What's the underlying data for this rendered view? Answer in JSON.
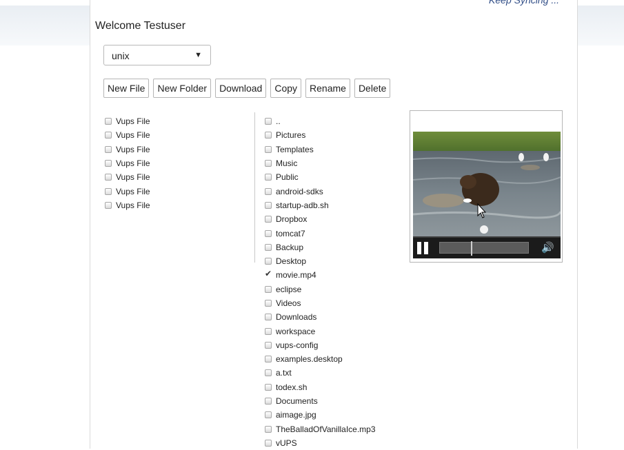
{
  "tagline": "Keep Syncing ...",
  "welcome": "Welcome Testuser",
  "select": {
    "value": "unix"
  },
  "toolbar": {
    "new_file": "New File",
    "new_folder": "New Folder",
    "download": "Download",
    "copy": "Copy",
    "rename": "Rename",
    "delete": "Delete"
  },
  "left_items": [
    "Vups File",
    "Vups File",
    "Vups File",
    "Vups File",
    "Vups File",
    "Vups File",
    "Vups File"
  ],
  "right_items": [
    {
      "label": "..",
      "checked": false
    },
    {
      "label": "Pictures",
      "checked": false
    },
    {
      "label": "Templates",
      "checked": false
    },
    {
      "label": "Music",
      "checked": false
    },
    {
      "label": "Public",
      "checked": false
    },
    {
      "label": "android-sdks",
      "checked": false
    },
    {
      "label": "startup-adb.sh",
      "checked": false
    },
    {
      "label": "Dropbox",
      "checked": false
    },
    {
      "label": "tomcat7",
      "checked": false
    },
    {
      "label": "Backup",
      "checked": false
    },
    {
      "label": "Desktop",
      "checked": false
    },
    {
      "label": "movie.mp4",
      "checked": true
    },
    {
      "label": "eclipse",
      "checked": false
    },
    {
      "label": "Videos",
      "checked": false
    },
    {
      "label": "Downloads",
      "checked": false
    },
    {
      "label": "workspace",
      "checked": false
    },
    {
      "label": "vups-config",
      "checked": false
    },
    {
      "label": "examples.desktop",
      "checked": false
    },
    {
      "label": "a.txt",
      "checked": false
    },
    {
      "label": "todex.sh",
      "checked": false
    },
    {
      "label": "Documents",
      "checked": false
    },
    {
      "label": "aimage.jpg",
      "checked": false
    },
    {
      "label": "TheBalladOfVanillaIce.mp3",
      "checked": false
    },
    {
      "label": "vUPS",
      "checked": false
    }
  ],
  "video": {
    "playing": true,
    "progress": 0.35,
    "icons": {
      "play_state": "pause-icon",
      "volume": "volume-icon"
    }
  }
}
